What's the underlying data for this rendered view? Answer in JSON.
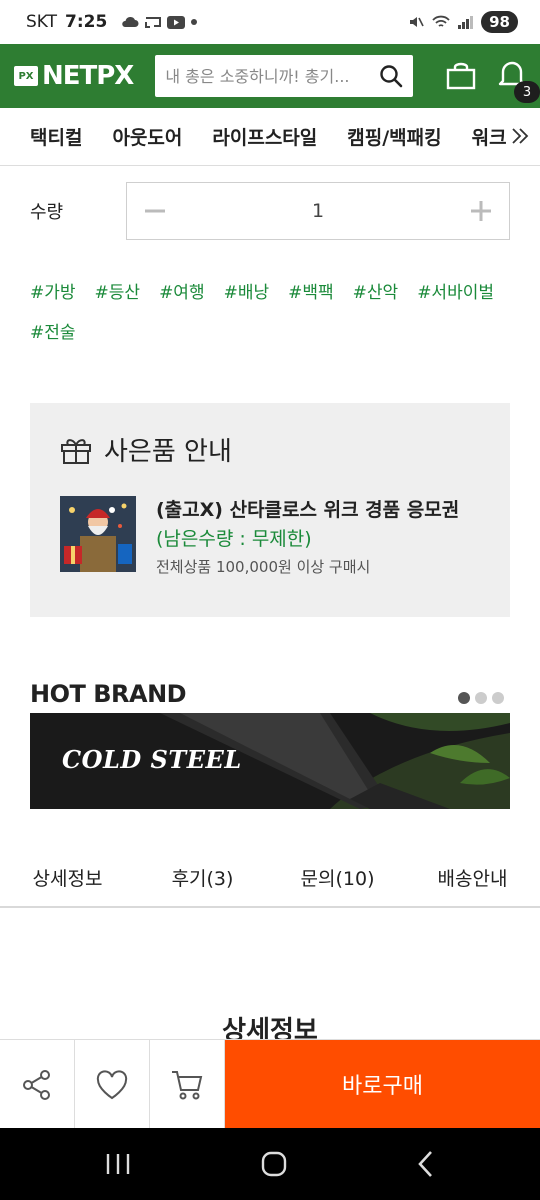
{
  "status_bar": {
    "carrier": "SKT",
    "time": "7:25",
    "battery": "98"
  },
  "header": {
    "logo_mark": "PX",
    "logo_text": "NETPX",
    "search_placeholder": "내 총은 소중하니까! 총기...",
    "notification_count": "3",
    "accent_color": "#2e7d32"
  },
  "categories": [
    "택티컬",
    "아웃도어",
    "라이프스타일",
    "캠핑/백패킹",
    "워크"
  ],
  "quantity": {
    "label": "수량",
    "value": "1"
  },
  "tags": [
    "#가방",
    "#등산",
    "#여행",
    "#배낭",
    "#백팩",
    "#산악",
    "#서바이벌",
    "#전술"
  ],
  "gift": {
    "title": "사은품 안내",
    "item_name": "(출고X) 산타클로스 위크 경품 응모권",
    "remaining": "(남은수량 : 무제한)",
    "condition": "전체상품 100,000원 이상 구매시"
  },
  "hot_brand": {
    "title": "HOT BRAND",
    "banner_brand": "COLD STEEL",
    "active_slide": 1,
    "slide_count": 3
  },
  "detail_tabs": [
    "상세정보",
    "후기(3)",
    "문의(10)",
    "배송안내"
  ],
  "detail_section_title": "상세정보",
  "action_bar": {
    "buy_label": "바로구매",
    "buy_color": "#ff4d00"
  }
}
